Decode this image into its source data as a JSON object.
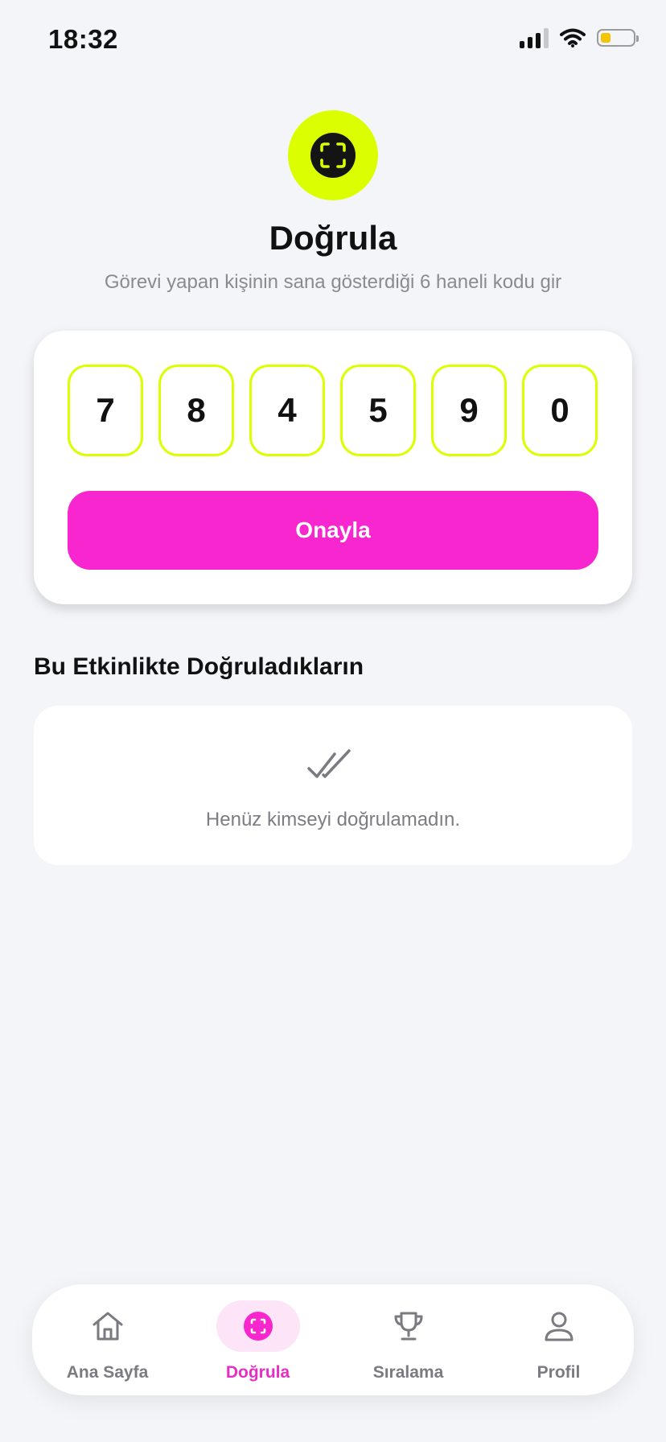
{
  "status_bar": {
    "time": "18:32"
  },
  "header": {
    "icon": "scan-frame-icon",
    "title": "Doğrula",
    "subtitle": "Görevi yapan kişinin sana gösterdiği 6 haneli kodu gir"
  },
  "code_entry": {
    "digits": [
      "7",
      "8",
      "4",
      "5",
      "9",
      "0"
    ],
    "confirm_label": "Onayla"
  },
  "verified_section": {
    "title": "Bu Etkinlikte Doğruladıkların",
    "empty_icon": "double-check-icon",
    "empty_text": "Henüz kimseyi doğrulamadın."
  },
  "tab_bar": {
    "items": [
      {
        "label": "Ana Sayfa",
        "icon": "home-icon",
        "active": false
      },
      {
        "label": "Doğrula",
        "icon": "scan-frame-icon",
        "active": true
      },
      {
        "label": "Sıralama",
        "icon": "trophy-icon",
        "active": false
      },
      {
        "label": "Profil",
        "icon": "user-icon",
        "active": false
      }
    ]
  },
  "colors": {
    "accent_lime": "#dcff00",
    "accent_magenta": "#f726cf",
    "background": "#f4f5f9"
  }
}
